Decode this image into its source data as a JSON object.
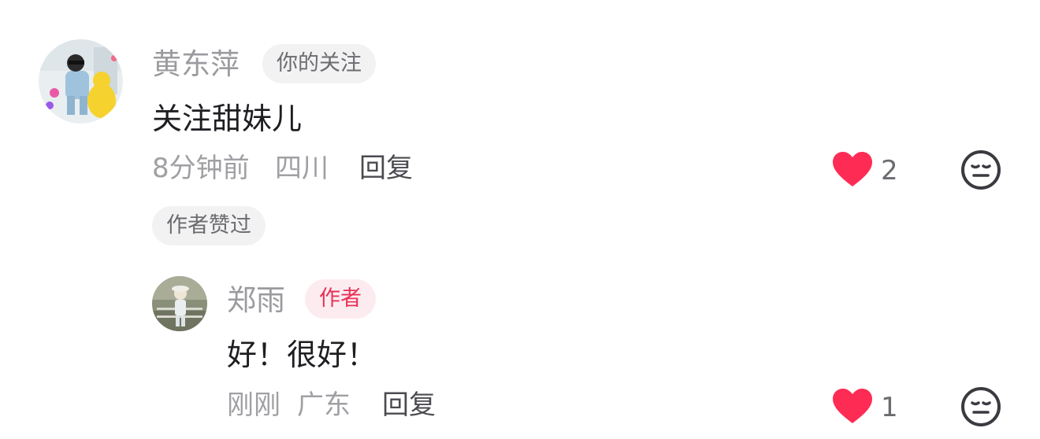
{
  "comments": [
    {
      "author": "黄东萍",
      "badge": "你的关注",
      "text": "关注甜妹儿",
      "time": "8分钟前",
      "location": "四川",
      "reply_label": "回复",
      "likes": "2",
      "extra_tag": "作者赞过",
      "avatar_icon": "user-avatar-photo"
    },
    {
      "author": "郑雨",
      "badge": "作者",
      "text": "好！很好！",
      "time": "刚刚",
      "location": "广东",
      "reply_label": "回复",
      "likes": "1",
      "avatar_icon": "user-avatar-photo"
    }
  ],
  "colors": {
    "heart": "#fe2c55",
    "author_tag_bg": "#fdecef",
    "author_tag_text": "#e83157",
    "gray_tag_bg": "#f2f2f3"
  },
  "icons": {
    "like": "heart-icon",
    "dislike": "neutral-face-icon"
  }
}
